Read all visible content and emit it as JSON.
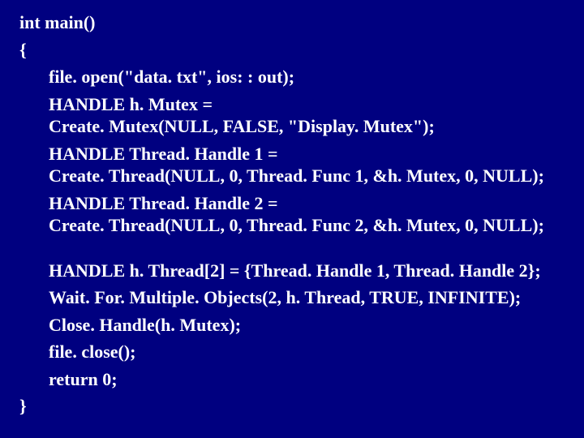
{
  "code": {
    "l1": "int main()",
    "l2": "{",
    "l3": "file. open(\"data. txt\", ios: : out);",
    "l4a": "HANDLE h. Mutex =",
    "l4b": "Create. Mutex(NULL, FALSE, \"Display. Mutex\");",
    "l5a": "HANDLE Thread. Handle 1 =",
    "l5b": "Create. Thread(NULL, 0, Thread. Func 1, &h. Mutex, 0, NULL);",
    "l6a": "HANDLE Thread. Handle 2 =",
    "l6b": "Create. Thread(NULL, 0, Thread. Func 2, &h. Mutex, 0, NULL);",
    "l7": "HANDLE h. Thread[2] = {Thread. Handle 1, Thread. Handle 2};",
    "l8": "Wait. For. Multiple. Objects(2, h. Thread, TRUE, INFINITE);",
    "l9": "Close. Handle(h. Mutex);",
    "l10": "file. close();",
    "l11": "return 0;",
    "l12": "}"
  }
}
